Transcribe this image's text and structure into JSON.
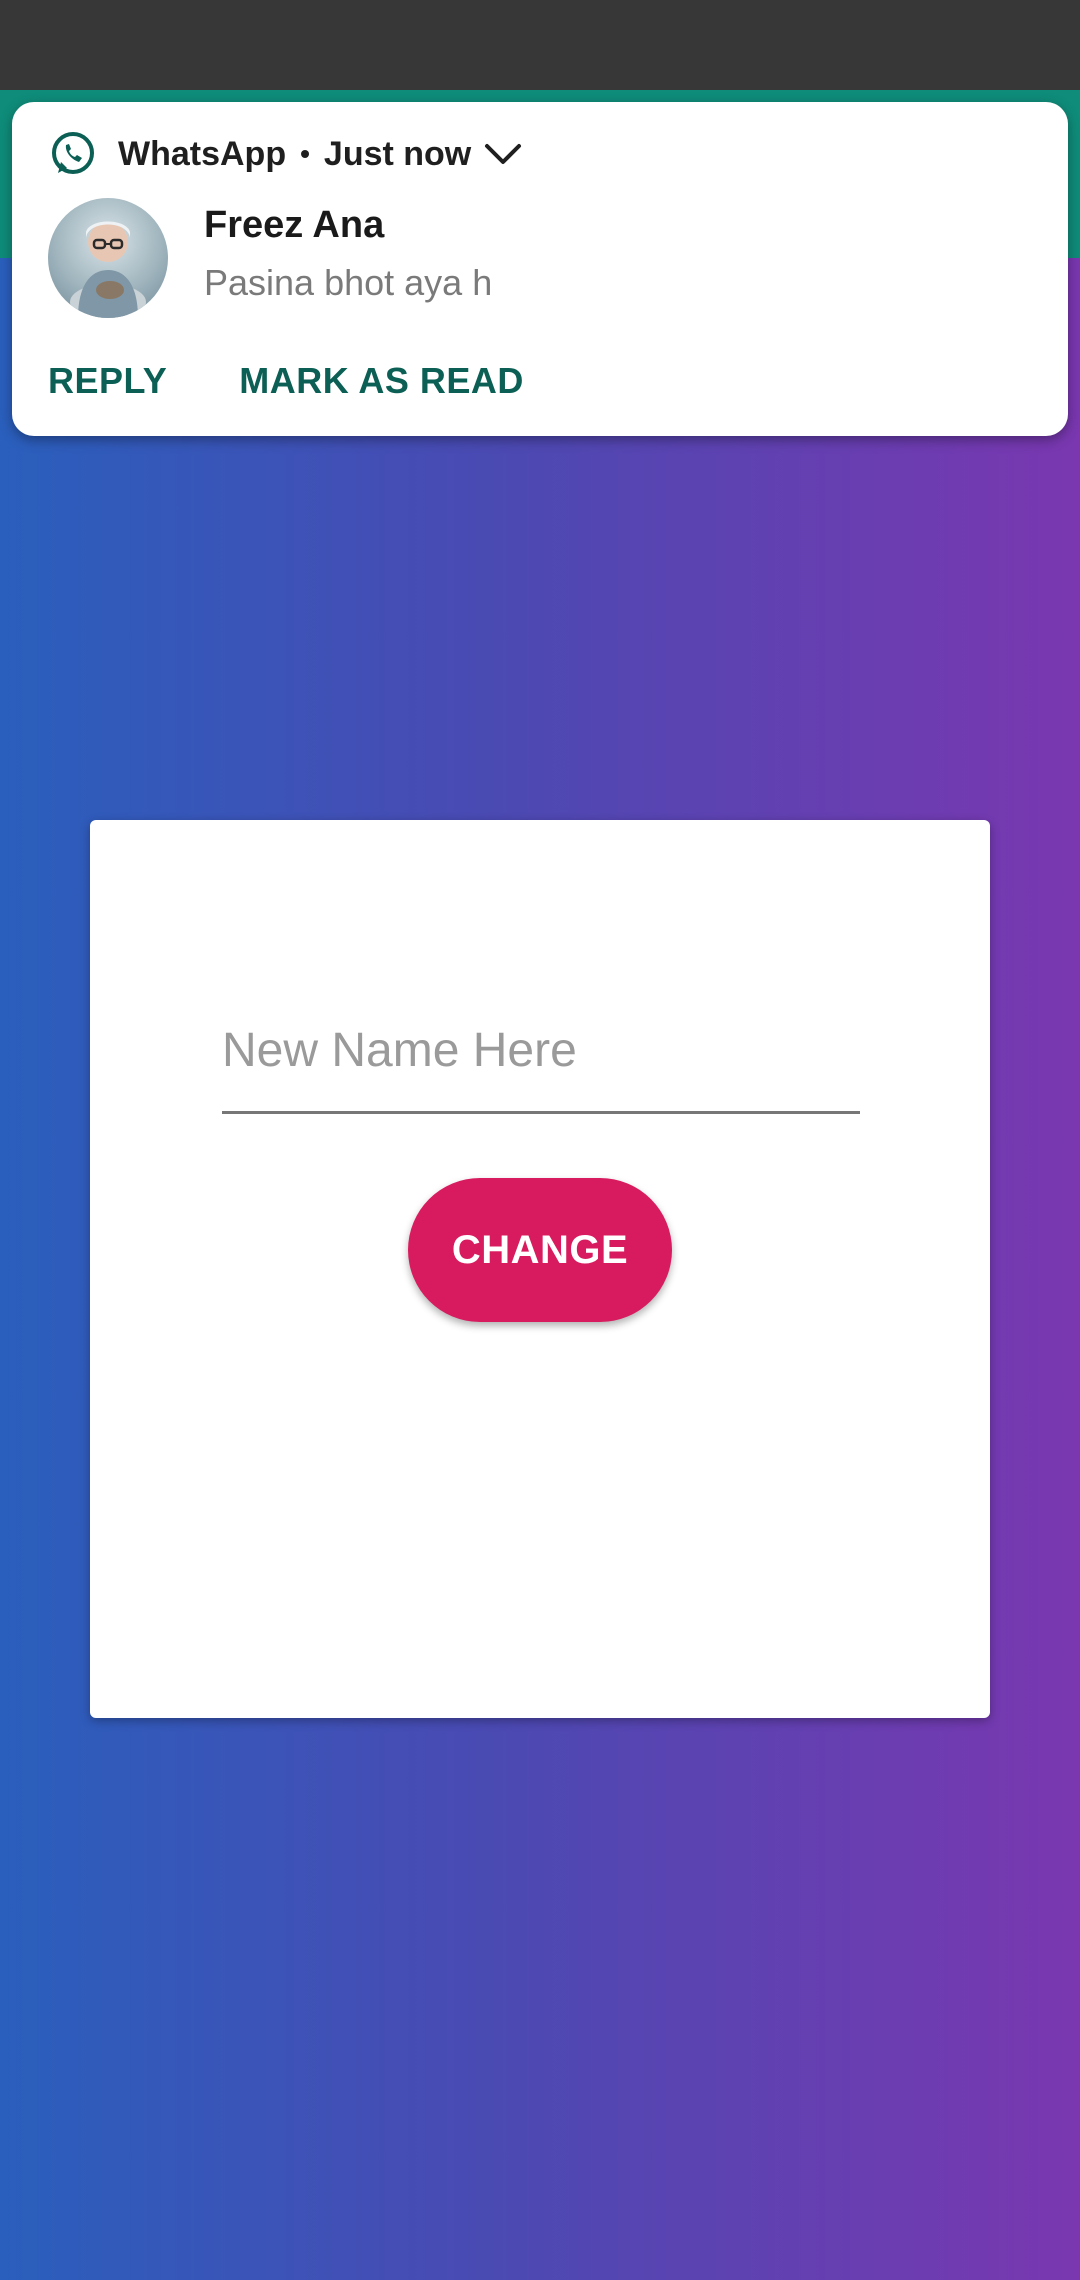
{
  "notification": {
    "app_name": "WhatsApp",
    "separator": "•",
    "time": "Just now",
    "sender": "Freez Ana",
    "message": "Pasina bhot aya h",
    "actions": {
      "reply": "REPLY",
      "mark_read": "MARK AS READ"
    },
    "app_icon": "whatsapp-icon",
    "expand_icon": "chevron-down-icon"
  },
  "form": {
    "name_placeholder": "New Name Here",
    "name_value": "",
    "change_label": "CHANGE"
  },
  "colors": {
    "status_bar": "#383737",
    "app_bar": "#0f8c7a",
    "background_start": "#2a5fbd",
    "background_end": "#7a37b0",
    "accent_button": "#d81b5e",
    "notification_action": "#0b5f54"
  }
}
